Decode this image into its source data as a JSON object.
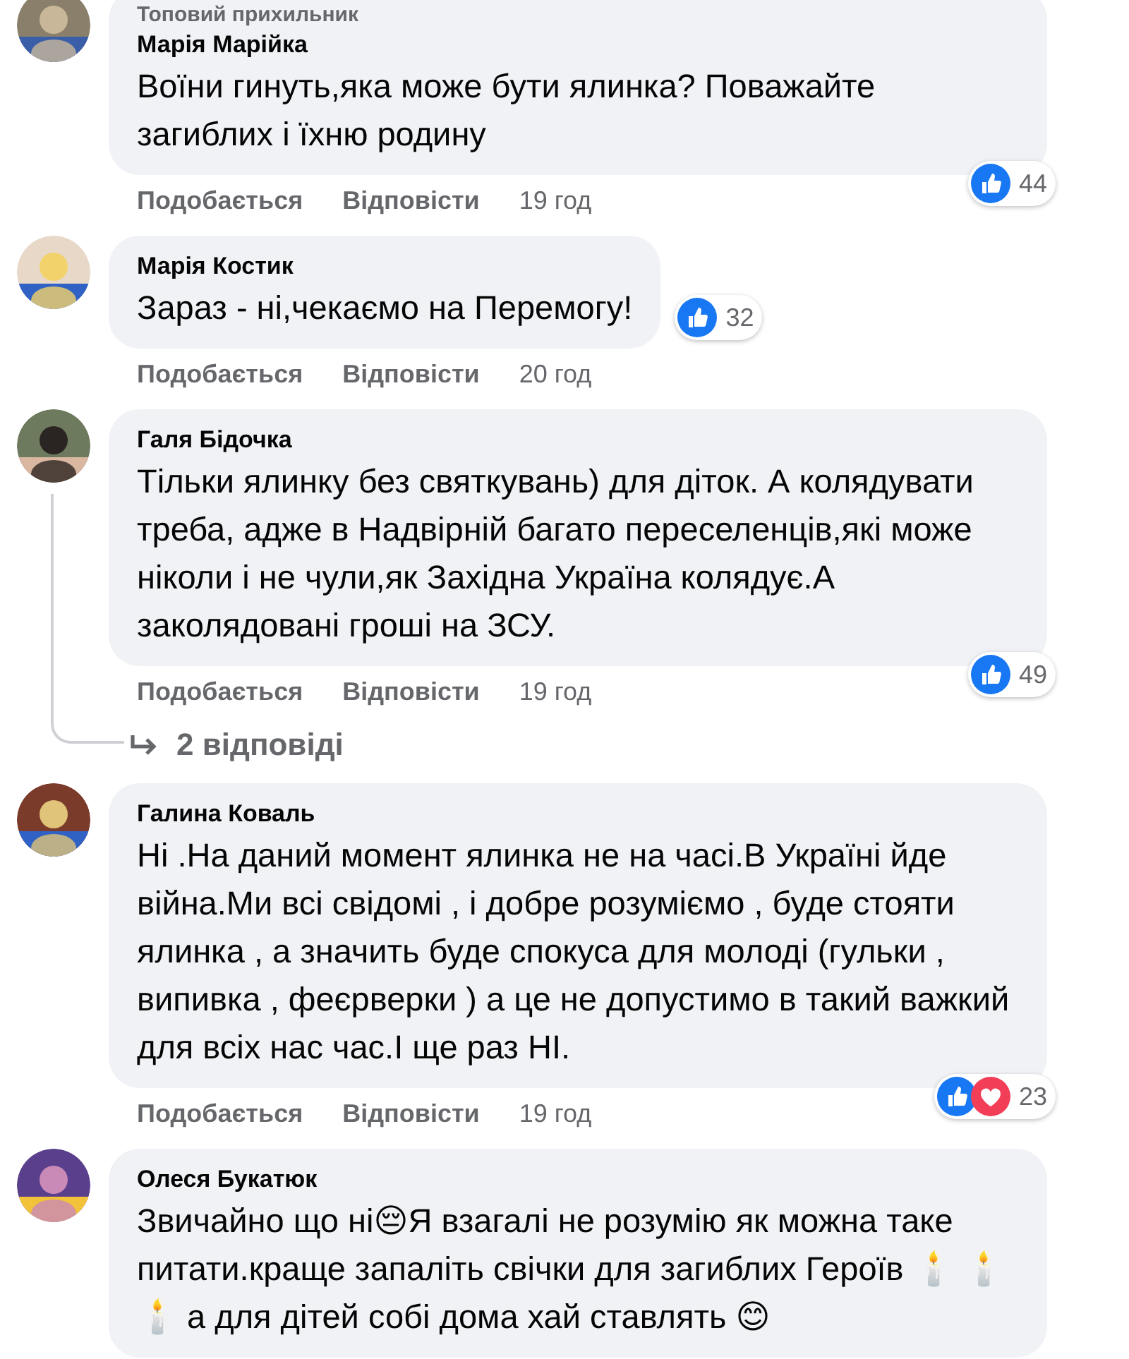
{
  "comments": [
    {
      "badge": "Топовий прихильник",
      "author": "Марія Марійка",
      "text": "Воїни гинуть,яка може бути ялинка? Поважайте загиблих і їхню родину",
      "actions": [
        "Подобається",
        "Відповісти"
      ],
      "time": "19 год",
      "reactions": [
        {
          "kind": "like"
        }
      ],
      "reaction_count": "44"
    },
    {
      "author": "Марія Костик",
      "text": "Зараз - ні,чекаємо на Перемогу!",
      "actions": [
        "Подобається",
        "Відповісти"
      ],
      "time": "20 год",
      "reactions": [
        {
          "kind": "like"
        }
      ],
      "reaction_count": "32"
    },
    {
      "author": "Галя Бідочка",
      "text": "Тільки ялинку без святкувань) для діток. А колядувати треба, адже в Надвірній багато переселенців,які може ніколи і не чули,як Західна Україна колядує.А заколядовані гроші на ЗСУ.",
      "actions": [
        "Подобається",
        "Відповісти"
      ],
      "time": "19 год",
      "reactions": [
        {
          "kind": "like"
        }
      ],
      "reaction_count": "49",
      "replies_link": "2 відповіді"
    },
    {
      "author": "Галина Коваль",
      "text": "Ні .На даний момент ялинка не на часі.В Україні йде війна.Ми всі свідомі , і добре розуміємо , буде стояти ялинка , а значить буде спокуса для молоді (гульки , випивка , феєрверки ) а це не допустимо в такий важкий для всіх нас час.І ще раз НІ.",
      "actions": [
        "Подобається",
        "Відповісти"
      ],
      "time": "19 год",
      "reactions": [
        {
          "kind": "like"
        },
        {
          "kind": "love"
        }
      ],
      "reaction_count": "23"
    },
    {
      "author": "Олеся Букатюк",
      "text": "Звичайно що ні😔Я взагалі не розумію як можна таке питати.краще запаліть свічки для загиблих Героїв 🕯️ 🕯️🕯️ а для дітей собі дома хай ставлять 😊"
    }
  ]
}
